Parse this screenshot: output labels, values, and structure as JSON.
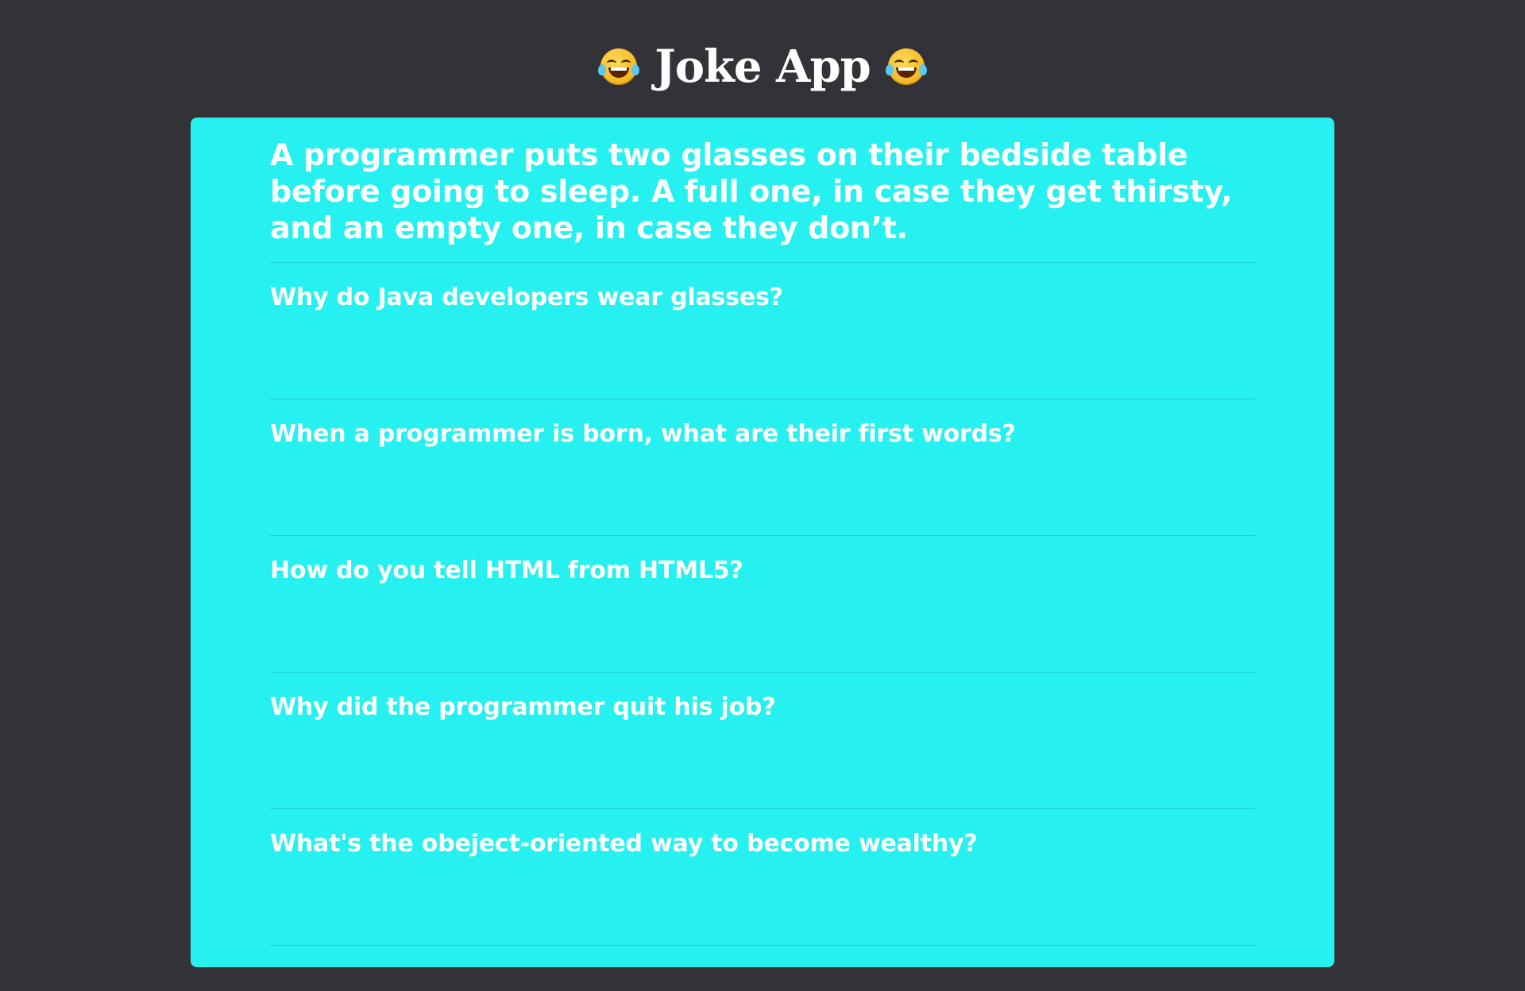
{
  "header": {
    "title": "Joke App",
    "left_icon": "joy-emoji-icon",
    "right_icon": "joy-emoji-icon"
  },
  "featured_joke": "A programmer puts two glasses on their bedside table before going to sleep. A full one, in case they get thirsty, and an empty one, in case they don’t.",
  "jokes": [
    "Why do Java developers wear glasses?",
    "When a programmer is born, what are their first words?",
    "How do you tell HTML from HTML5?",
    "Why did the programmer quit his job?",
    "What's the obeject-oriented way to become wealthy?"
  ],
  "colors": {
    "background": "#333238",
    "card": "#26f0f0",
    "text": "#ffffff"
  }
}
